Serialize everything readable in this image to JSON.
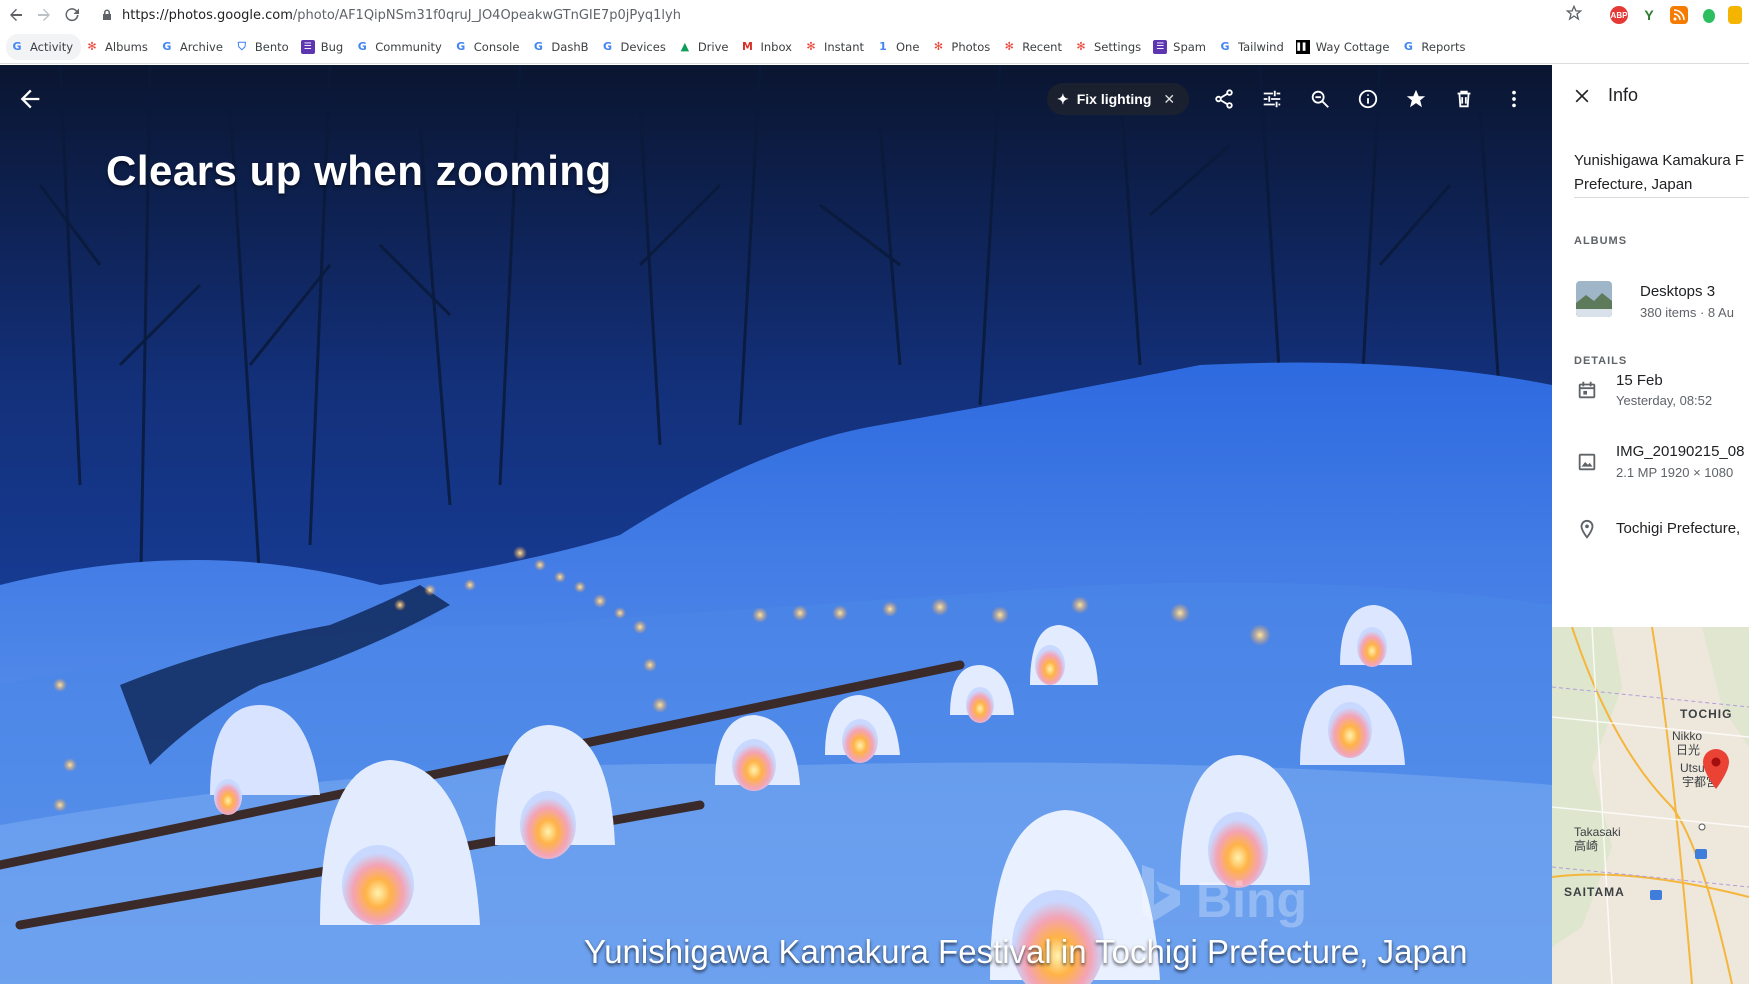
{
  "browser": {
    "url_host": "https://photos.google.com",
    "url_path": "/photo/AF1QipNSm31f0qruJ_JO4OpeakwGTnGIE7p0jPyq1lyh"
  },
  "bookmarks": [
    {
      "label": "Activity",
      "icon": "google-g-icon",
      "color": "#4285f4"
    },
    {
      "label": "Albums",
      "icon": "photos-pinwheel-icon",
      "color": "#ea4335"
    },
    {
      "label": "Archive",
      "icon": "google-g-icon",
      "color": "#4285f4"
    },
    {
      "label": "Bento",
      "icon": "shield-icon",
      "color": "#4285f4"
    },
    {
      "label": "Bug",
      "icon": "list-box-icon",
      "color": "#5e35b1"
    },
    {
      "label": "Community",
      "icon": "google-g-icon",
      "color": "#4285f4"
    },
    {
      "label": "Console",
      "icon": "google-g-icon",
      "color": "#4285f4"
    },
    {
      "label": "DashB",
      "icon": "google-g-icon",
      "color": "#4285f4"
    },
    {
      "label": "Devices",
      "icon": "google-g-icon",
      "color": "#4285f4"
    },
    {
      "label": "Drive",
      "icon": "drive-triangle-icon",
      "color": "#0f9d58"
    },
    {
      "label": "Inbox",
      "icon": "gmail-m-icon",
      "color": "#d93025"
    },
    {
      "label": "Instant",
      "icon": "photos-pinwheel-icon",
      "color": "#ea4335"
    },
    {
      "label": "One",
      "icon": "google-one-icon",
      "color": "#4285f4"
    },
    {
      "label": "Photos",
      "icon": "photos-pinwheel-icon",
      "color": "#ea4335"
    },
    {
      "label": "Recent",
      "icon": "photos-pinwheel-icon",
      "color": "#ea4335"
    },
    {
      "label": "Settings",
      "icon": "photos-pinwheel-icon",
      "color": "#ea4335"
    },
    {
      "label": "Spam",
      "icon": "list-box-icon",
      "color": "#5e35b1"
    },
    {
      "label": "Tailwind",
      "icon": "google-g-icon",
      "color": "#4285f4"
    },
    {
      "label": "Way Cottage",
      "icon": "bars-black-icon",
      "color": "#000000"
    },
    {
      "label": "Reports",
      "icon": "google-g-icon",
      "color": "#4285f4"
    }
  ],
  "viewer": {
    "caption_top": "Clears up when zooming",
    "caption_bottom": "Yunishigawa Kamakura Festival in Tochigi Prefecture, Japan",
    "watermark": "Bing",
    "fix_lighting_label": "Fix lighting"
  },
  "info": {
    "title": "Info",
    "description_line1": "Yunishigawa Kamakura F",
    "description_line2": "Prefecture, Japan",
    "albums_header": "ALBUMS",
    "album_name": "Desktops 3",
    "album_meta": "380 items  ·  8 Au",
    "details_header": "DETAILS",
    "date": "15 Feb",
    "date_sub": "Yesterday, 08:52",
    "file_name": "IMG_20190215_08",
    "file_meta": "2.1 MP    1920 × 1080",
    "location": "Tochigi Prefecture,"
  },
  "map": {
    "labels": [
      "TOCHIG",
      "Nikko",
      "日光",
      "Utsu",
      "宇都宮",
      "Takasaki",
      "高崎",
      "SAITAMA"
    ]
  }
}
